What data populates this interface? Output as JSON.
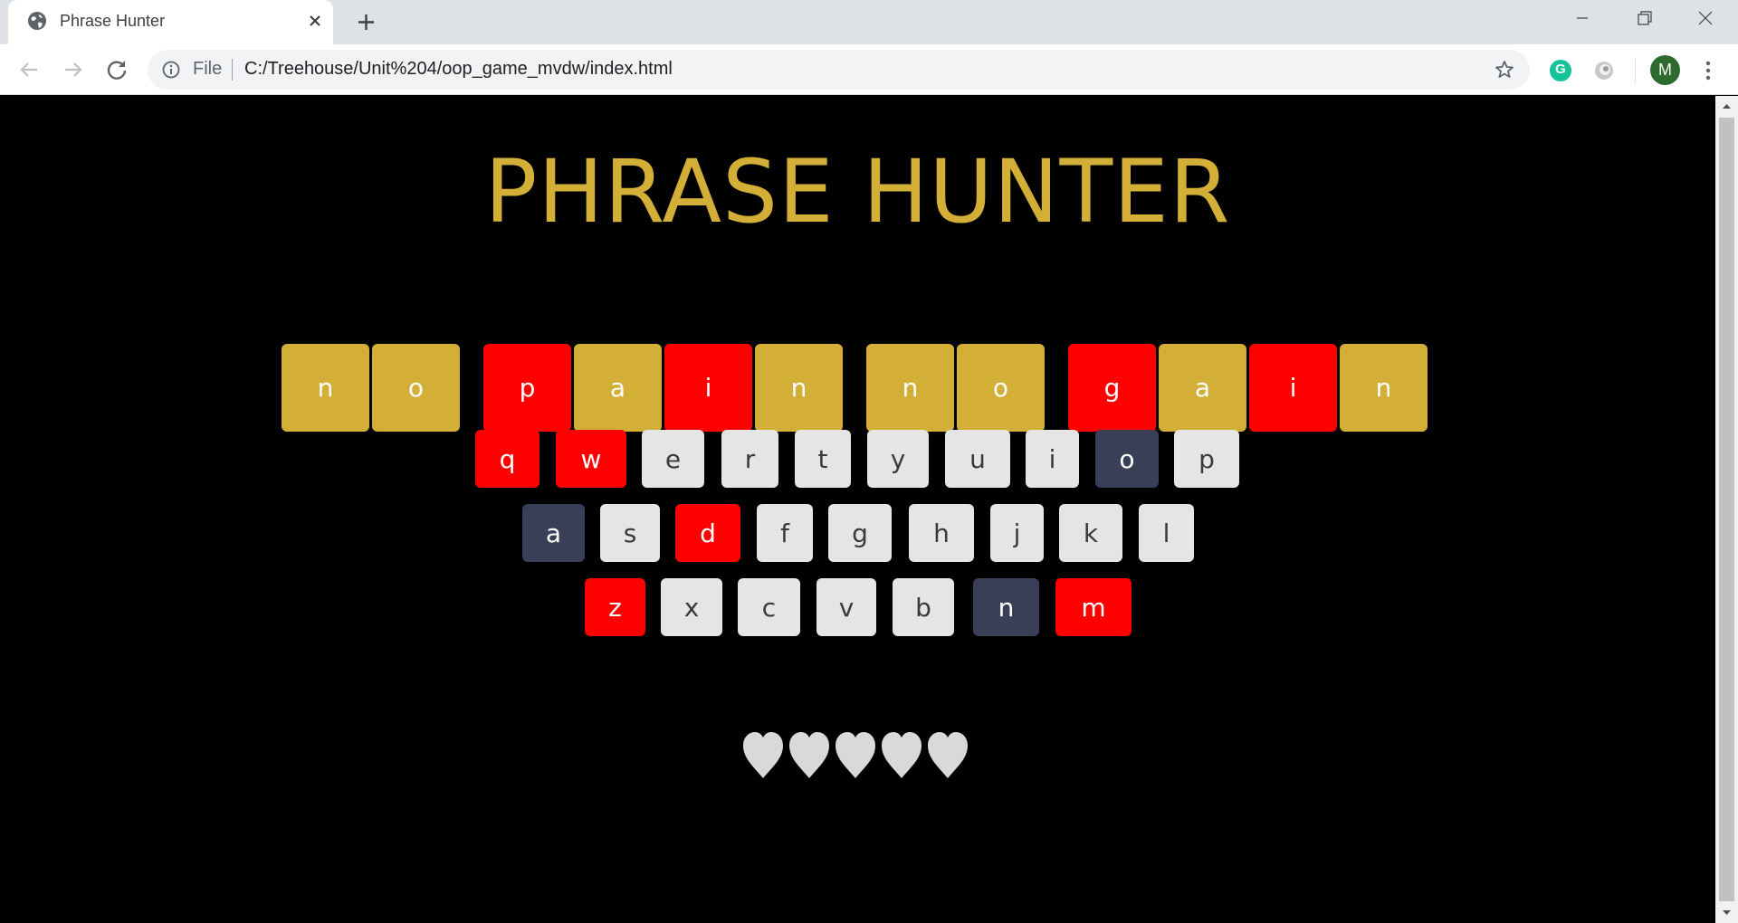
{
  "browser": {
    "tab_title": "Phrase Hunter",
    "omnibox_scheme": "File",
    "url": "C:/Treehouse/Unit%204/oop_game_mvdw/index.html",
    "grammarly_letter": "G",
    "avatar_letter": "M"
  },
  "game": {
    "title": "PHRASE HUNTER",
    "phrase_tiles": [
      {
        "letter": "n",
        "state": "shown"
      },
      {
        "letter": "o",
        "state": "shown"
      },
      {
        "letter": "p",
        "state": "hidden"
      },
      {
        "letter": "a",
        "state": "shown"
      },
      {
        "letter": "i",
        "state": "hidden"
      },
      {
        "letter": "n",
        "state": "shown"
      },
      {
        "letter": "n",
        "state": "shown"
      },
      {
        "letter": "o",
        "state": "shown"
      },
      {
        "letter": "g",
        "state": "hidden"
      },
      {
        "letter": "a",
        "state": "shown"
      },
      {
        "letter": "i",
        "state": "hidden"
      },
      {
        "letter": "n",
        "state": "shown"
      }
    ],
    "keyboard_rows": [
      [
        {
          "letter": "q",
          "state": "wrong"
        },
        {
          "letter": "w",
          "state": "wrong"
        },
        {
          "letter": "e",
          "state": "unused"
        },
        {
          "letter": "r",
          "state": "unused"
        },
        {
          "letter": "t",
          "state": "unused"
        },
        {
          "letter": "y",
          "state": "unused"
        },
        {
          "letter": "u",
          "state": "unused"
        },
        {
          "letter": "i",
          "state": "unused"
        },
        {
          "letter": "o",
          "state": "chosen"
        },
        {
          "letter": "p",
          "state": "unused"
        }
      ],
      [
        {
          "letter": "a",
          "state": "chosen"
        },
        {
          "letter": "s",
          "state": "unused"
        },
        {
          "letter": "d",
          "state": "wrong"
        },
        {
          "letter": "f",
          "state": "unused"
        },
        {
          "letter": "g",
          "state": "unused"
        },
        {
          "letter": "h",
          "state": "unused"
        },
        {
          "letter": "j",
          "state": "unused"
        },
        {
          "letter": "k",
          "state": "unused"
        },
        {
          "letter": "l",
          "state": "unused"
        }
      ],
      [
        {
          "letter": "z",
          "state": "wrong"
        },
        {
          "letter": "x",
          "state": "unused"
        },
        {
          "letter": "c",
          "state": "unused"
        },
        {
          "letter": "v",
          "state": "unused"
        },
        {
          "letter": "b",
          "state": "unused"
        },
        {
          "letter": "n",
          "state": "chosen"
        },
        {
          "letter": "m",
          "state": "wrong"
        }
      ]
    ],
    "lives": {
      "total": 5,
      "remaining": 5
    }
  },
  "colors": {
    "title": "#d4af37",
    "tile_shown": "#d4af37",
    "tile_hidden": "#ff0000",
    "key_unused": "#e5e5e5",
    "key_wrong": "#ff0000",
    "key_chosen": "#3a3f58",
    "heart": "#d9d9d9"
  },
  "icons": {
    "tab": "globe-icon",
    "close": "close-icon",
    "new_tab": "plus-icon",
    "back": "arrow-left-icon",
    "forward": "arrow-right-icon",
    "reload": "reload-icon",
    "info": "info-icon",
    "star": "star-icon",
    "menu": "kebab-menu-icon",
    "life": "heart-icon"
  }
}
